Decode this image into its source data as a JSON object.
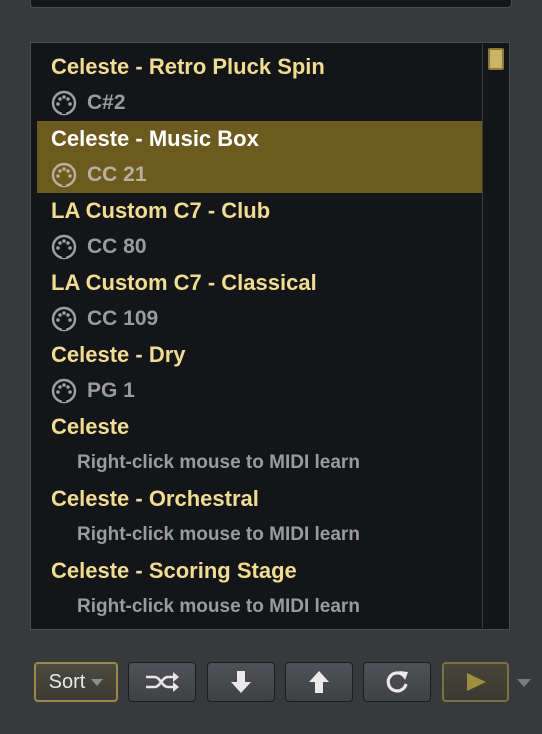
{
  "items": [
    {
      "title": "Celeste - Retro Pluck Spin",
      "sub": "C#2",
      "icon": "midi-icon",
      "selected": false
    },
    {
      "title": "Celeste - Music Box",
      "sub": "CC 21",
      "icon": "midi-icon",
      "selected": true
    },
    {
      "title": "LA Custom C7 - Club",
      "sub": "CC 80",
      "icon": "midi-icon",
      "selected": false
    },
    {
      "title": "LA Custom C7 - Classical",
      "sub": "CC 109",
      "icon": "midi-icon",
      "selected": false
    },
    {
      "title": "Celeste - Dry",
      "sub": "PG 1",
      "icon": "midi-icon",
      "selected": false
    },
    {
      "title": "Celeste",
      "sub": "Right-click mouse to MIDI learn",
      "icon": null,
      "selected": false
    },
    {
      "title": "Celeste - Orchestral",
      "sub": "Right-click mouse to MIDI learn",
      "icon": null,
      "selected": false
    },
    {
      "title": "Celeste - Scoring Stage",
      "sub": "Right-click mouse to MIDI learn",
      "icon": null,
      "selected": false
    }
  ],
  "toolbar": {
    "sort_label": "Sort",
    "buttons": [
      "shuffle-icon",
      "arrow-down-icon",
      "arrow-up-icon",
      "refresh-icon",
      "play-icon"
    ]
  },
  "colors": {
    "title": "#f1dd92",
    "selected_bg": "#6c5a1f",
    "sub": "#9a9ba0",
    "accent": "#c9b564"
  }
}
